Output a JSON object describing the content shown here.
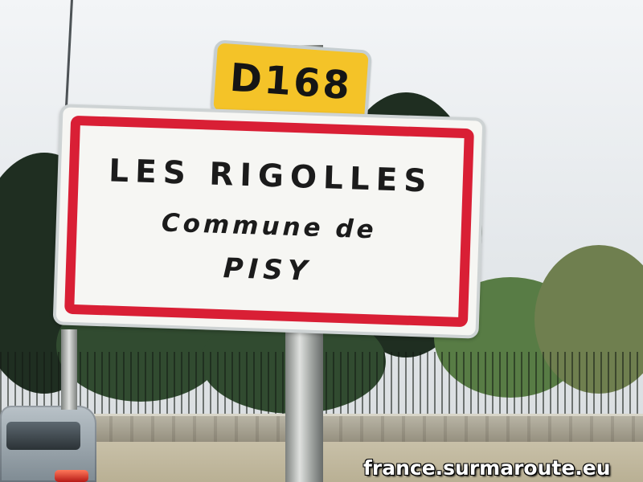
{
  "route_sign": {
    "text": "D168",
    "color": "#f4c328"
  },
  "town_sign": {
    "name": "LES RIGOLLES",
    "subtitle": "Commune de",
    "commune": "PISY",
    "border_color": "#d91f35"
  },
  "watermark": {
    "text": "france.surmaroute.eu"
  }
}
